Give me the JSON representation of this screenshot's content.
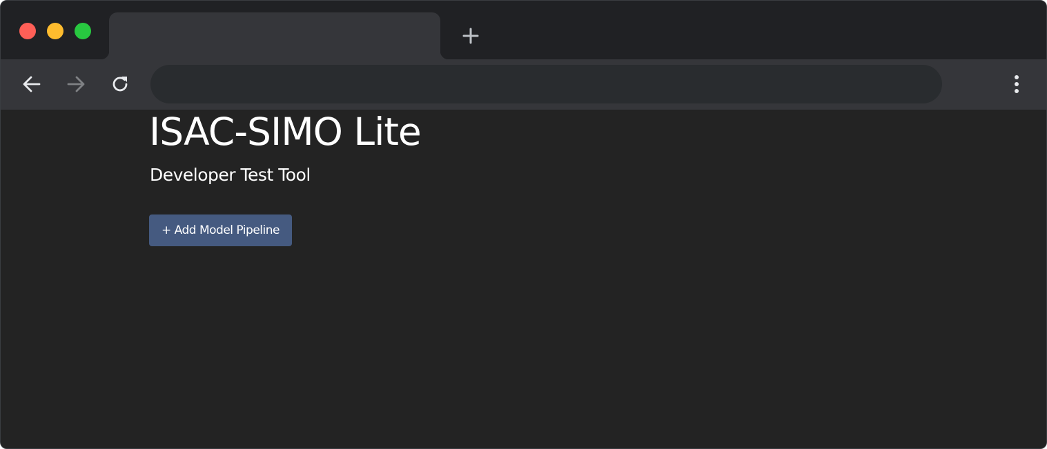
{
  "browser": {
    "tab": {
      "title": ""
    },
    "address_bar": {
      "value": "",
      "placeholder": ""
    },
    "colors": {
      "traffic_red": "#ff5f57",
      "traffic_yellow": "#febc2e",
      "traffic_green": "#28c840",
      "icon": "#e8eaed",
      "icon_disabled": "#7f8184"
    },
    "icons": {
      "back": "arrow-left-icon",
      "forward": "arrow-right-icon",
      "reload": "reload-icon",
      "new_tab": "plus-icon",
      "menu": "more-vertical-icon"
    }
  },
  "page": {
    "title": "ISAC-SIMO Lite",
    "subtitle": "Developer Test Tool",
    "add_button_label": "+ Add Model Pipeline",
    "colors": {
      "background": "#232323",
      "button": "#455a80",
      "text": "#ffffff"
    }
  }
}
